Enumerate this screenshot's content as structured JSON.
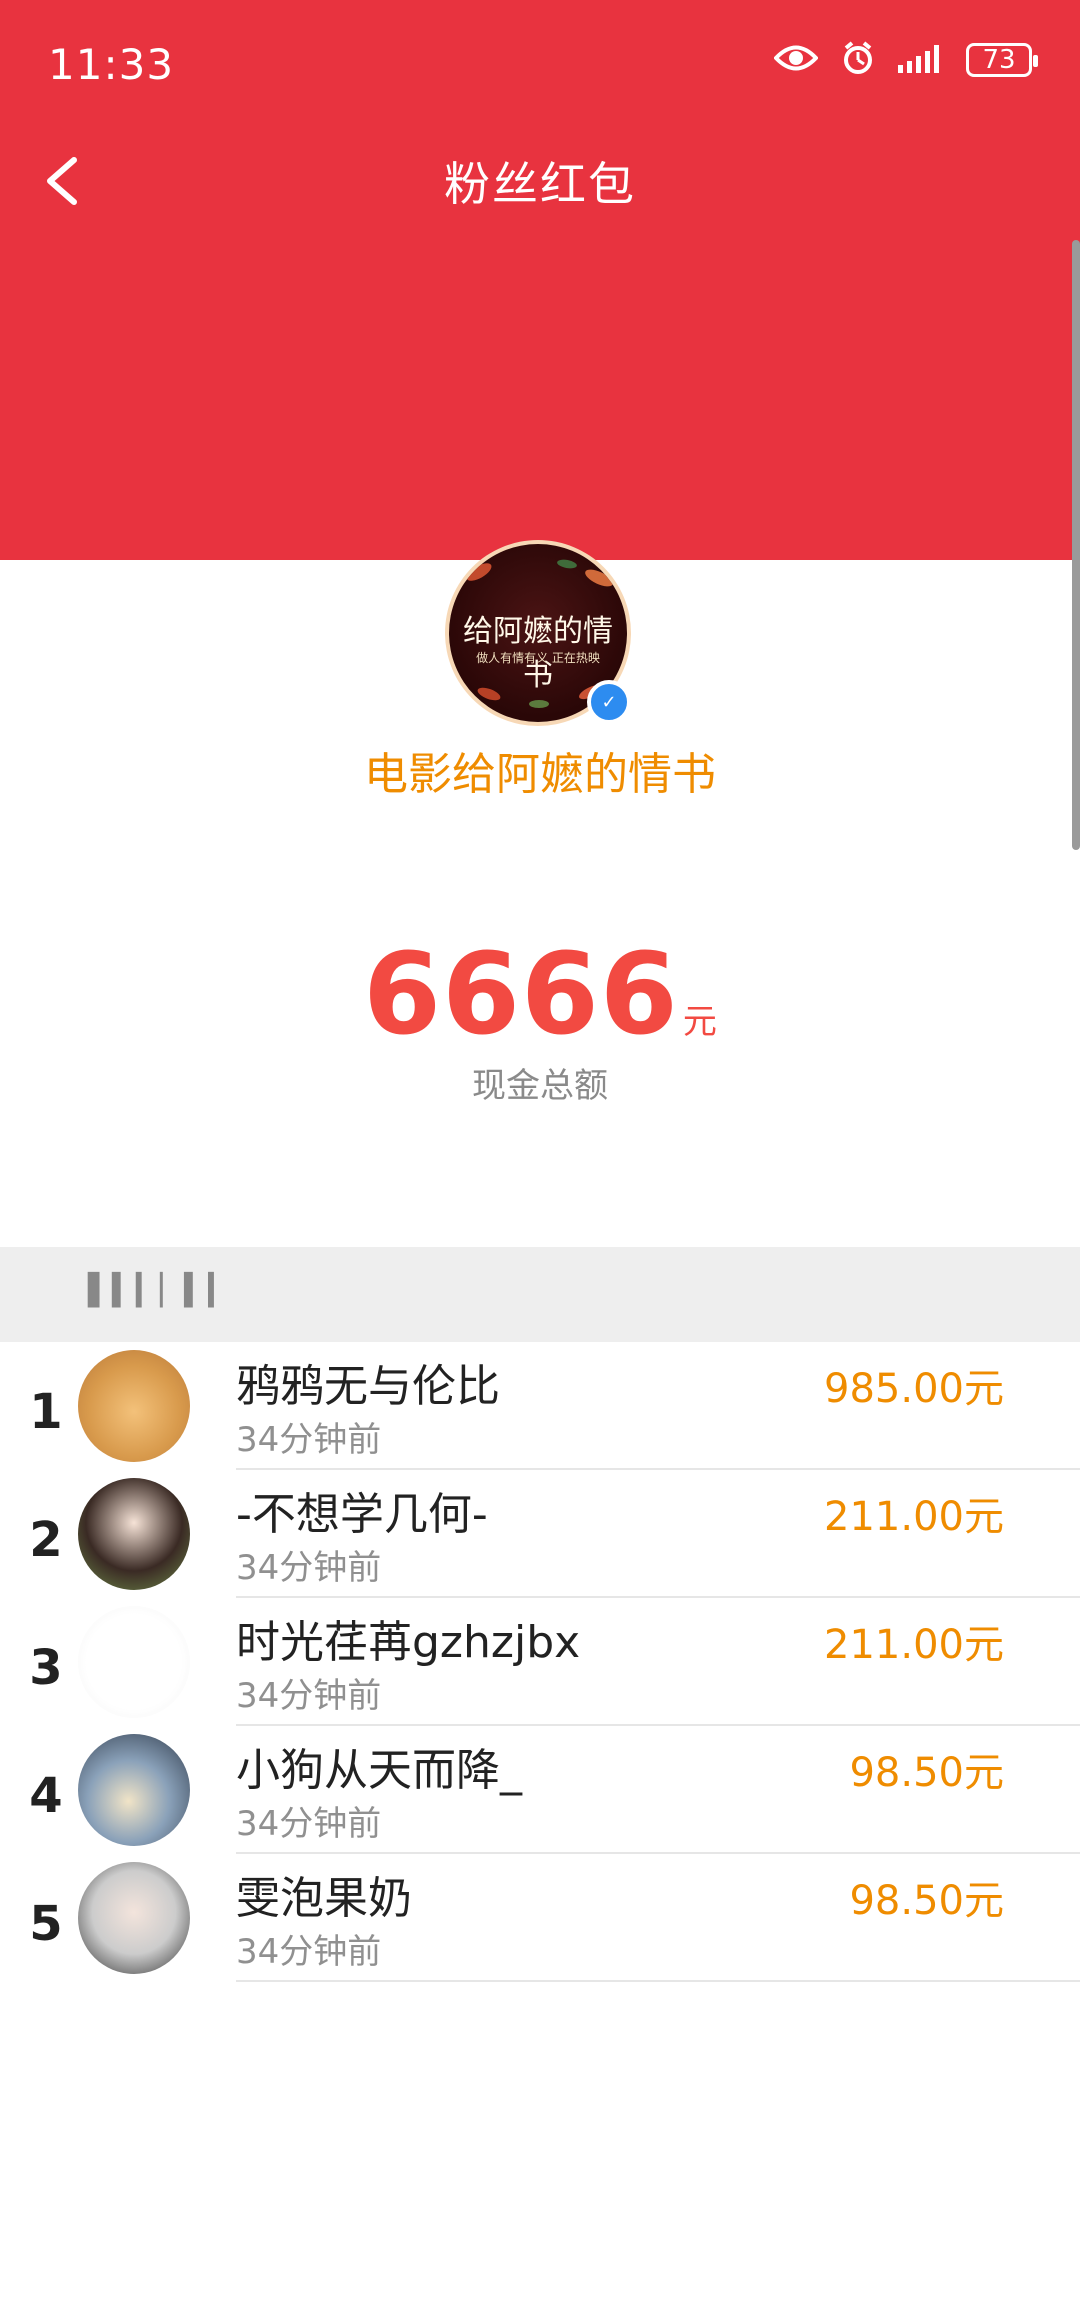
{
  "status_bar": {
    "time": "11:33",
    "battery": "73"
  },
  "nav": {
    "title": "粉丝红包"
  },
  "account": {
    "name": "电影给阿嬷的情书",
    "avatar_text": "给阿嬷的情书",
    "avatar_subtext": "做人有情有义 正在热映",
    "verified": true
  },
  "summary": {
    "amount": "6666",
    "unit": "元",
    "label": "现金总额"
  },
  "section": {
    "title": "▌▍▎▏▍▎"
  },
  "list": [
    {
      "rank": "1",
      "name": "鸦鸦无与伦比",
      "time": "34分钟前",
      "amount": "985.00元"
    },
    {
      "rank": "2",
      "name": "-不想学几何-",
      "time": "34分钟前",
      "amount": "211.00元"
    },
    {
      "rank": "3",
      "name": "时光荏苒gzhzjbx",
      "time": "34分钟前",
      "amount": "211.00元"
    },
    {
      "rank": "4",
      "name": "小狗从天而降_",
      "time": "34分钟前",
      "amount": "98.50元"
    },
    {
      "rank": "5",
      "name": "雯泡果奶",
      "time": "34分钟前",
      "amount": "98.50元"
    }
  ],
  "colors": {
    "header_red": "#e8333f",
    "accent_orange": "#ef8c00",
    "amount_red": "#f24a42"
  }
}
